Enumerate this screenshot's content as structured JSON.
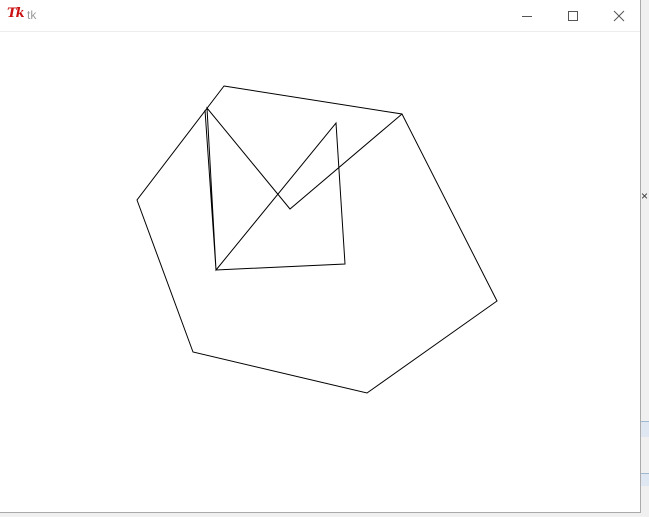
{
  "window": {
    "title": "tk",
    "icon": "tk-feather-icon",
    "controls": [
      "minimize-icon",
      "maximize-icon",
      "close-icon"
    ]
  },
  "background_window": {
    "visible_glyph": "×"
  },
  "canvas": {
    "shapes": [
      {
        "type": "polygon",
        "label": "hexagon"
      },
      {
        "type": "polyline",
        "label": "inner-figure"
      }
    ]
  },
  "colors": {
    "stroke": "#000000",
    "canvas_bg": "#ffffff",
    "title_text": "#9a9a9a",
    "icon": "#cc1111"
  }
}
